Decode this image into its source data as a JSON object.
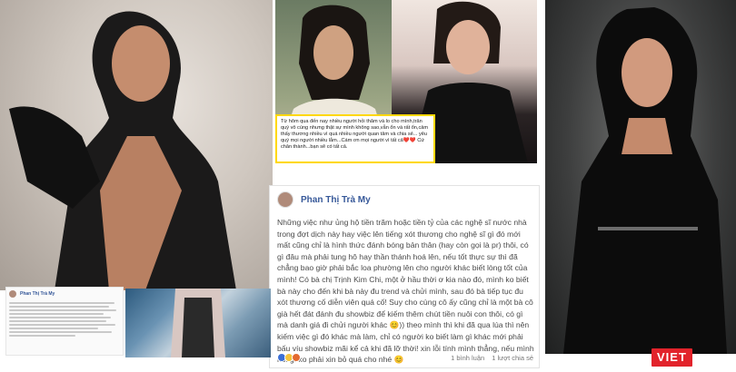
{
  "top_caption": {
    "text": "Từ hôm qua đến nay nhiều người hỏi thăm và lo cho mình,trân quý vô cùng nhưng thật sự mình không sao,vẫn ổn và rất ổn,cảm thấy thương nhiều vì quá nhiều người quan tâm và chia sẻ... yêu quý mọi người nhiều lắm...Cám ơn mọi người vì tất cả❤️❤️ Cứ chân thành...bạn sẽ có tất cả."
  },
  "post": {
    "author": "Phan Thị Trà My",
    "body": "Những việc như ủng hộ tiền trăm hoặc tiền tỷ của các nghệ sĩ nước nhà trong đợt dịch này hay việc lên tiếng xót thương cho nghệ sĩ gì đó mới mất cũng chỉ là hình thức đánh bóng bản thân (hay còn gọi là pr) thôi, có gì đâu mà phải tung hô hay thần thánh hoá lên, nếu tốt thực sự thì đã chẳng bao giờ phải bắc loa phường lên cho người khác biết lòng tốt của mình! Có bà chị Trịnh Kim Chi, một ở hầu thời ơ kia nào đó, mình ko biết bà này cho đến khi bà này đu trend và chửi mình, sau đó bà tiếp tục đu xót thương cố diễn viên quá cố! Suy cho cùng cô ấy cũng chỉ là một bà cô già hết đát đánh đu showbiz để kiếm thêm chút tiền nuôi con thôi, có gì mà danh giá đi chửi người khác 😊)) theo mình thì khi đã qua lúa thì nên kiếm việc gì đó khác mà làm, chỉ có người ko biết làm gì khác mới phải bấu víu showbiz mãi kể cả khi đã lỡ thời! xin lỗi tính mình thẳng, nếu mình nói gì ko phải xin bỏ quá cho nhé 😊",
    "comments": "1 bình luận",
    "shares": "1 lượt chia sẻ"
  },
  "small_post": {
    "author": "Phan Thị Trà My"
  },
  "badge": {
    "label": "VIET"
  },
  "colors": {
    "caption_border": "#ffd800",
    "author_link": "#365899",
    "badge_bg": "#e2232b"
  }
}
